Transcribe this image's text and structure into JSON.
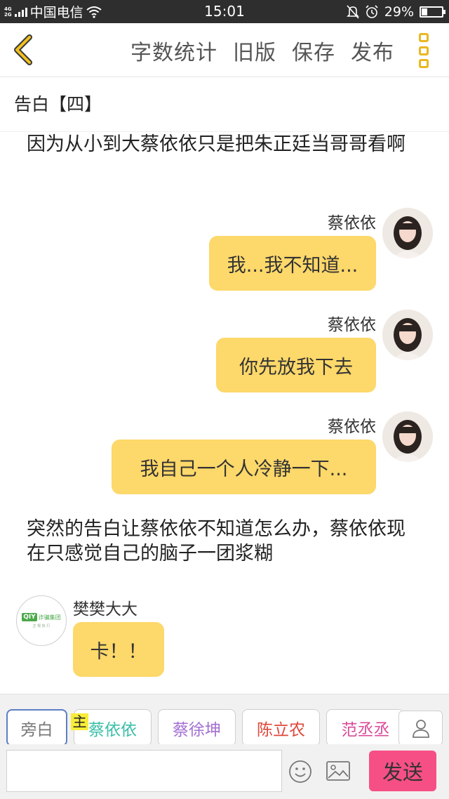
{
  "status_bar": {
    "net_top": "4G",
    "net_bottom": "2G",
    "carrier": "中国电信",
    "time": "15:01",
    "battery_percent": "29%",
    "battery_level": 0.29
  },
  "toolbar": {
    "actions": [
      {
        "label": "字数统计"
      },
      {
        "label": "旧版"
      },
      {
        "label": "保存"
      },
      {
        "label": "发布"
      }
    ]
  },
  "chapter": {
    "title": "告白【四】"
  },
  "messages": {
    "narration_1": "因为从小到大蔡依依只是把朱正廷当哥哥看啊",
    "chat_1": {
      "name": "蔡依依",
      "text": "我...我不知道..."
    },
    "chat_2": {
      "name": "蔡依依",
      "text": "你先放我下去"
    },
    "chat_3": {
      "name": "蔡依依",
      "text": "我自己一个人冷静一下..."
    },
    "narration_2": "突然的告白让蔡依依不知道怎么办，蔡依依现在只感觉自己的脑子一团浆糊",
    "chat_4": {
      "name": "樊樊大大",
      "text": "卡！！",
      "avatar_logo": "QIY",
      "avatar_logo_text": "诈骗集团",
      "avatar_logo_sub": "正 规 执 行"
    }
  },
  "roles": [
    {
      "label": "旁白",
      "color": "#777777",
      "active": true
    },
    {
      "label": "蔡依依",
      "color": "#3bbfa8",
      "active": false
    },
    {
      "label": "蔡徐坤",
      "color": "#a56fd2",
      "active": false
    },
    {
      "label": "陈立农",
      "color": "#e0473a",
      "active": false
    },
    {
      "label": "范丞丞",
      "color": "#d94a9a",
      "active": false
    }
  ],
  "main_badge": "主",
  "input": {
    "value": "",
    "placeholder": ""
  },
  "send_label": "发送",
  "icons": {
    "back": "chevron-left-icon",
    "more": "vertical-dots-icon",
    "add_role": "person-icon",
    "emoji": "smiley-icon",
    "image": "image-icon",
    "wifi": "wifi-icon",
    "mute": "bell-mute-icon",
    "alarm": "alarm-icon"
  },
  "colors": {
    "bubble": "#fdd86a",
    "accent_yellow": "#e8b820",
    "send_button": "#f64f85",
    "status_bar": "#2e2e2e"
  }
}
